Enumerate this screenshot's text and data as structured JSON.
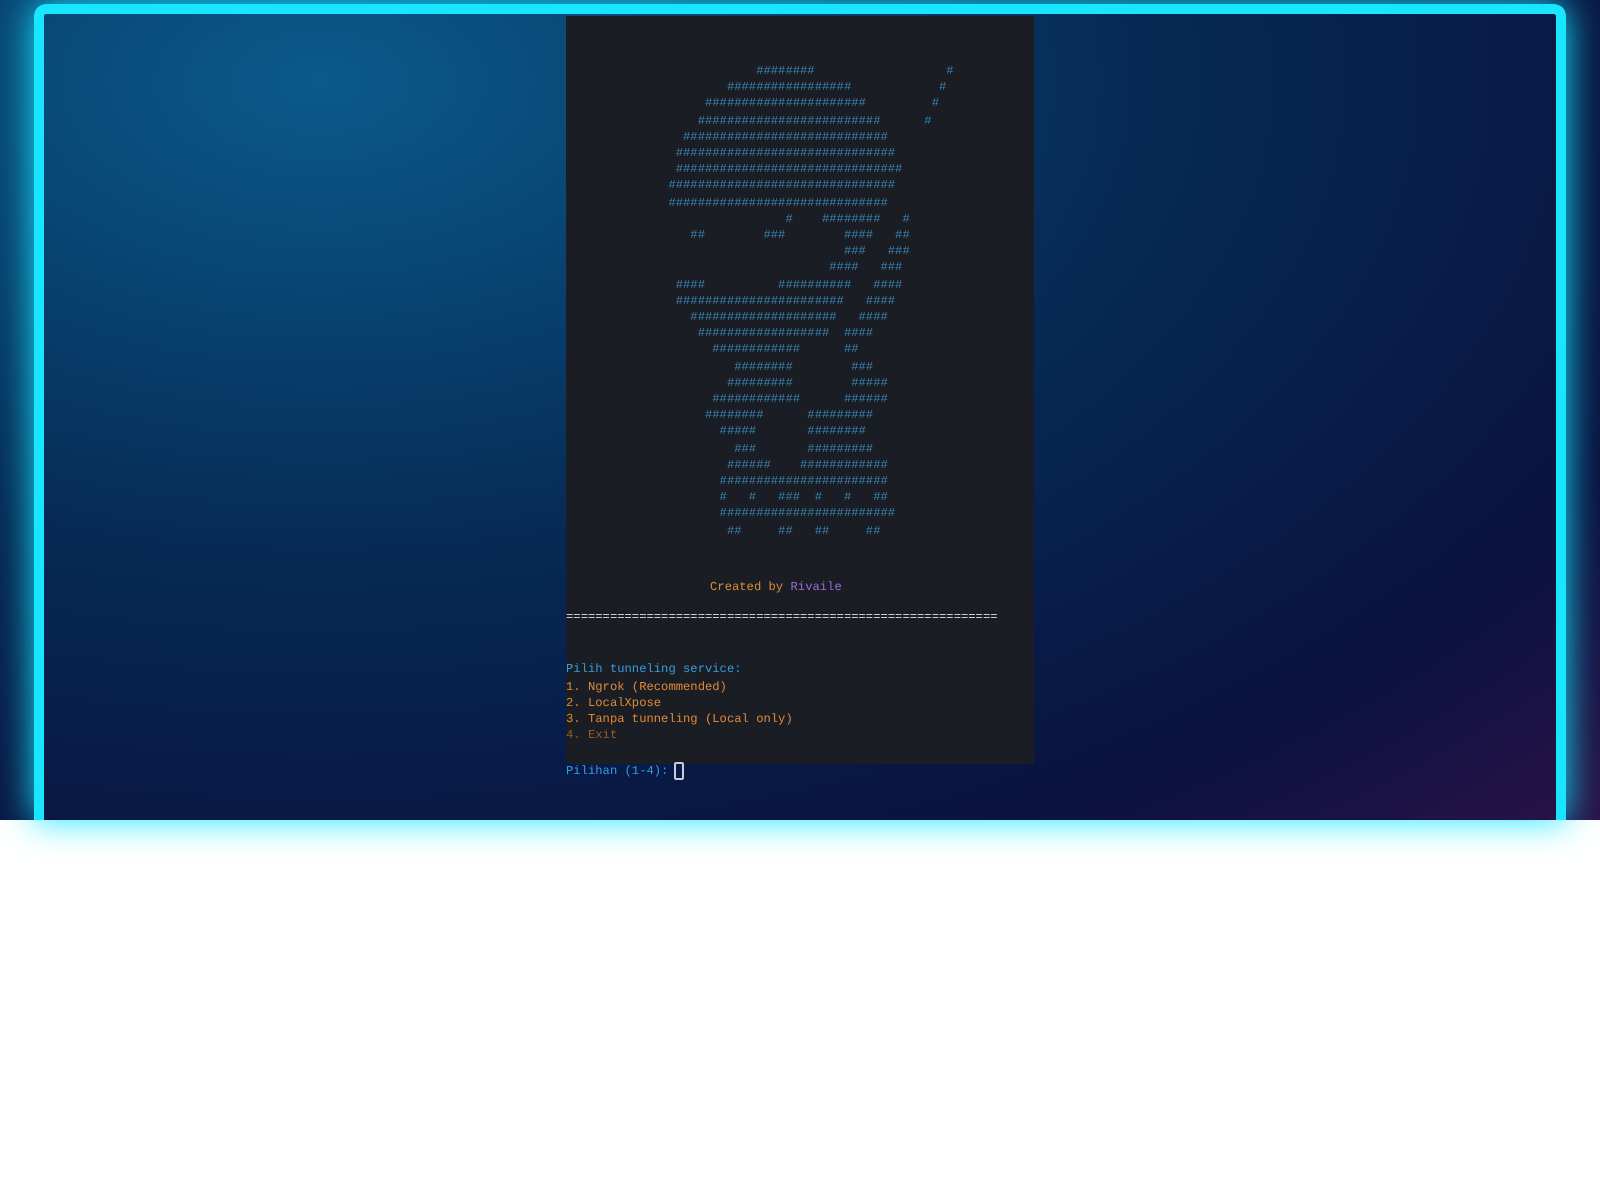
{
  "terminal": {
    "ascii_art": [
      "                          ########                  #",
      "                      #################            #",
      "                   ######################         #",
      "                  #########################      #",
      "                ############################",
      "               ##############################",
      "               ###############################",
      "              ###############################",
      "              ##############################",
      "                              #    ########   #",
      "                 ##        ###        ####   ##",
      "                                      ###   ###",
      "                                    ####   ###",
      "               ####          ##########   ####",
      "               #######################   ####",
      "                 ####################   ####",
      "                  ##################  ####",
      "                    ############      ##",
      "                       ########        ###",
      "                      #########        #####",
      "                    ############      ######",
      "                   ########      #########",
      "                     #####       ########",
      "                       ###       #########",
      "                      ######    ############",
      "                     #######################",
      "                     #   #   ###  #   #   ##",
      "                     ########################",
      "                      ##     ##   ##     ##"
    ],
    "credit": {
      "prefix": "Created by",
      "name": "Rivaile"
    },
    "separator": "===========================================================",
    "menu": {
      "title": "Pilih tunneling service:",
      "options": [
        {
          "text": "1. Ngrok (Recommended)",
          "color": "#e0883a"
        },
        {
          "text": "2. LocalXpose",
          "color": "#e0883a"
        },
        {
          "text": "3. Tanpa tunneling (Local only)",
          "color": "#e0883a"
        },
        {
          "text": "4. Exit",
          "color": "#9a5a2a"
        }
      ]
    },
    "prompt": {
      "label": "Pilihan (1-4):"
    }
  }
}
